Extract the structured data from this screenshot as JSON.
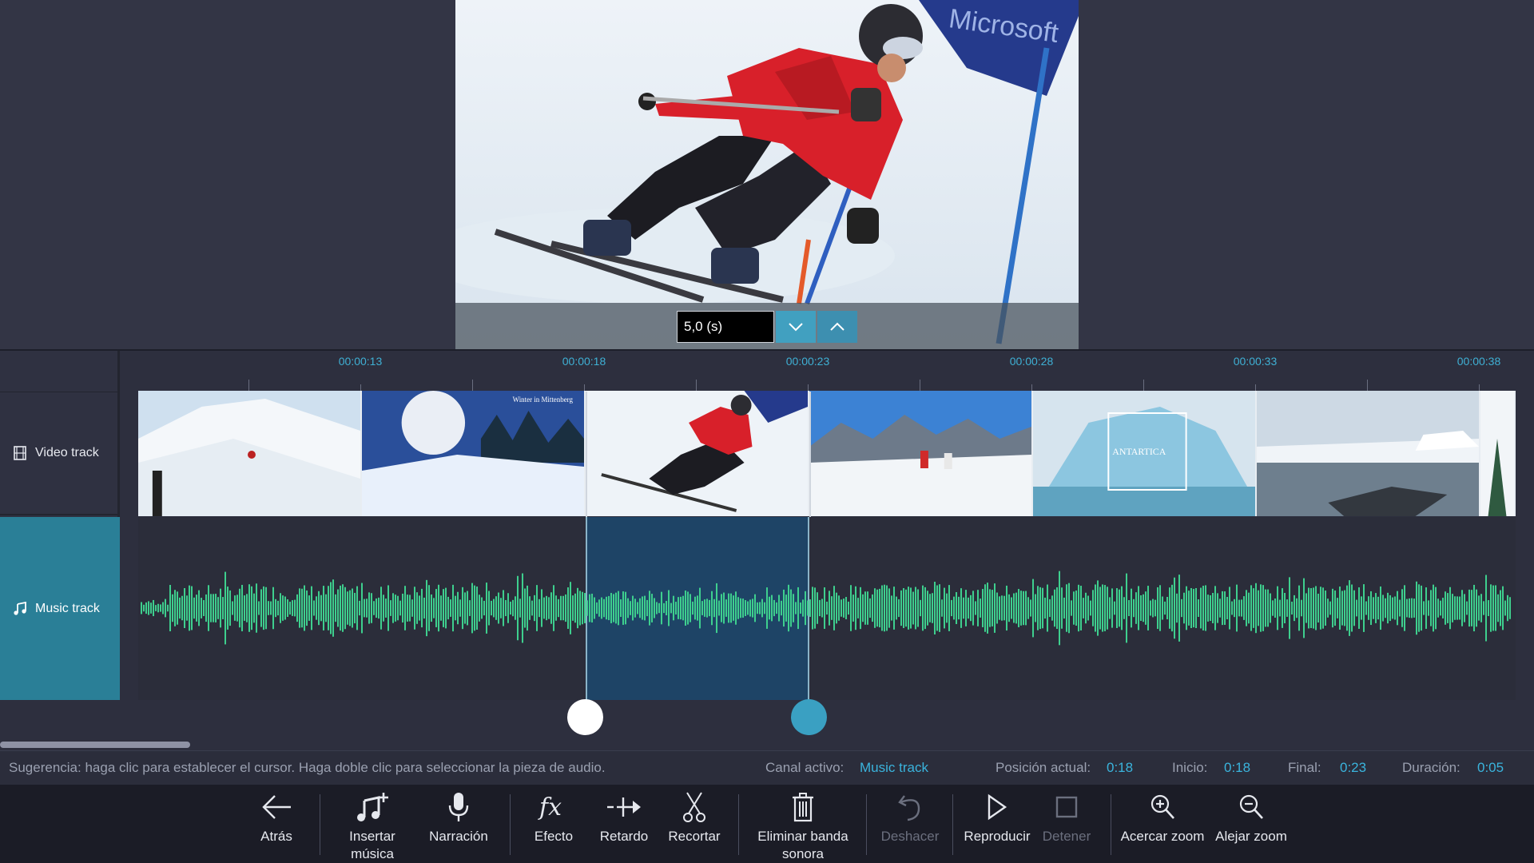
{
  "preview": {
    "banner_text": "Microsoft",
    "duration_value": "5,0 (s)"
  },
  "tracks": {
    "video_label": "Video track",
    "music_label": "Music track"
  },
  "ruler": {
    "labels": [
      "00:00:13",
      "00:00:18",
      "00:00:23",
      "00:00:28",
      "00:00:33",
      "00:00:38"
    ]
  },
  "clips": [
    {
      "name": "snowy-slope"
    },
    {
      "name": "winter-sun",
      "caption": "Winter in Mittenberg"
    },
    {
      "name": "skier-slalom"
    },
    {
      "name": "mountain-hikers"
    },
    {
      "name": "antartica-iceberg",
      "caption": "ANTARTICA"
    },
    {
      "name": "polar-shore"
    },
    {
      "name": "snowy-trees"
    }
  ],
  "status": {
    "hint": "Sugerencia: haga clic para establecer el cursor. Haga doble clic para seleccionar la pieza de audio.",
    "active_channel_label": "Canal activo:",
    "active_channel_value": "Music track",
    "position_label": "Posición actual:",
    "position_value": "0:18",
    "start_label": "Inicio:",
    "start_value": "0:18",
    "end_label": "Final:",
    "end_value": "0:23",
    "duration_label": "Duración:",
    "duration_value": "0:05"
  },
  "toolbar": {
    "back": "Atrás",
    "insert_music_1": "Insertar",
    "insert_music_2": "música",
    "narration": "Narración",
    "effect": "Efecto",
    "delay": "Retardo",
    "trim": "Recortar",
    "delete_track_1": "Eliminar banda",
    "delete_track_2": "sonora",
    "undo": "Deshacer",
    "play": "Reproducir",
    "stop": "Detener",
    "zoom_in": "Acercar zoom",
    "zoom_out": "Alejar zoom"
  },
  "colors": {
    "accent": "#3ab4dd",
    "waveform": "#3ecf8e",
    "selection": "#1e4466",
    "music_track_bg": "#2a7f97"
  }
}
